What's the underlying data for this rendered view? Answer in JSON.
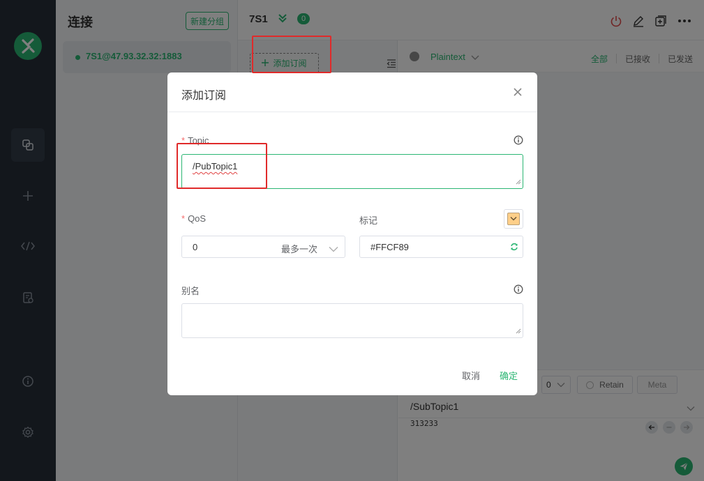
{
  "sidebar": {
    "title": "连接",
    "new_group_label": "新建分组",
    "connections": [
      {
        "name": "7S1@47.93.32.32:1883",
        "status_color": "#2bb673"
      }
    ]
  },
  "header": {
    "connection_name": "7S1",
    "unread_count": "0"
  },
  "subscriptions": {
    "add_label": "添加订阅"
  },
  "messages": {
    "format_label": "Plaintext",
    "filters": {
      "all": "全部",
      "received": "已接收",
      "sent": "已发送"
    }
  },
  "publish": {
    "qos": "0",
    "retain_label": "Retain",
    "meta_label": "Meta",
    "topic": "/SubTopic1",
    "payload": "313233"
  },
  "dialog": {
    "title": "添加订阅",
    "topic_label": "Topic",
    "topic_value": "/PubTopic1",
    "qos_label": "QoS",
    "qos_value": "0",
    "qos_description": "最多一次",
    "color_label": "标记",
    "color_value": "#FFCF89",
    "alias_label": "别名",
    "alias_value": "",
    "cancel_label": "取消",
    "confirm_label": "确定"
  },
  "theme": {
    "accent": "#2bb673",
    "nav_bg": "#262e38",
    "annotation": "#e02a2a"
  }
}
